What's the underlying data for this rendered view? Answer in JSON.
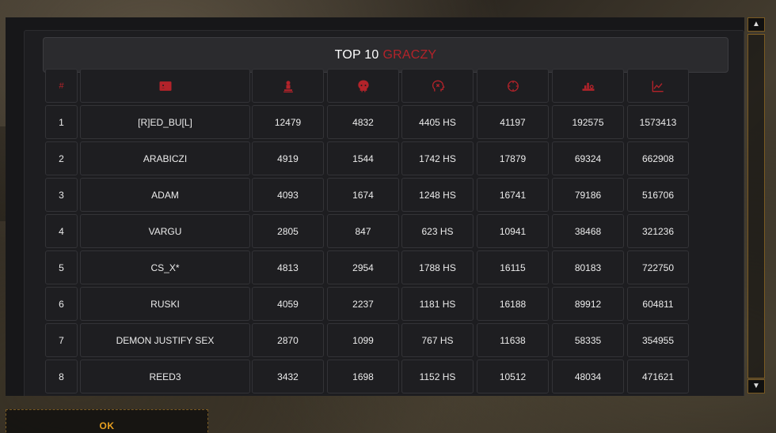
{
  "title": {
    "main": "TOP 10",
    "accent": "GRACZY"
  },
  "columns": [
    {
      "key": "rank",
      "label": "#",
      "icon": null
    },
    {
      "key": "name",
      "label": "",
      "icon": "id-card-icon"
    },
    {
      "key": "kills",
      "label": "",
      "icon": "tombstone-icon"
    },
    {
      "key": "deaths",
      "label": "",
      "icon": "skull-icon"
    },
    {
      "key": "headshots",
      "label": "",
      "icon": "head-target-icon"
    },
    {
      "key": "shots",
      "label": "",
      "icon": "crosshair-icon"
    },
    {
      "key": "damage",
      "label": "",
      "icon": "weights-icon"
    },
    {
      "key": "points",
      "label": "",
      "icon": "chart-icon"
    }
  ],
  "rows": [
    [
      "1",
      "[R]ED_BU[L]",
      "12479",
      "4832",
      "4405 HS",
      "41197",
      "192575",
      "1573413"
    ],
    [
      "2",
      "ARABICZI",
      "4919",
      "1544",
      "1742 HS",
      "17879",
      "69324",
      "662908"
    ],
    [
      "3",
      "ADAM",
      "4093",
      "1674",
      "1248 HS",
      "16741",
      "79186",
      "516706"
    ],
    [
      "4",
      "VARGU",
      "2805",
      "847",
      "623 HS",
      "10941",
      "38468",
      "321236"
    ],
    [
      "5",
      "CS_X*",
      "4813",
      "2954",
      "1788 HS",
      "16115",
      "80183",
      "722750"
    ],
    [
      "6",
      "RUSKI",
      "4059",
      "2237",
      "1181 HS",
      "16188",
      "89912",
      "604811"
    ],
    [
      "7",
      "DEMON JUSTIFY SEX",
      "2870",
      "1099",
      "767 HS",
      "11638",
      "58335",
      "354955"
    ],
    [
      "8",
      "REED3",
      "3432",
      "1698",
      "1152 HS",
      "10512",
      "48034",
      "471621"
    ]
  ],
  "scroll": {
    "up": "▲",
    "down": "▼"
  },
  "ok_button": {
    "label": "OK"
  },
  "colors": {
    "accent": "#b3232a",
    "button_text": "#e8a020",
    "border_gold": "#7a5a22"
  }
}
